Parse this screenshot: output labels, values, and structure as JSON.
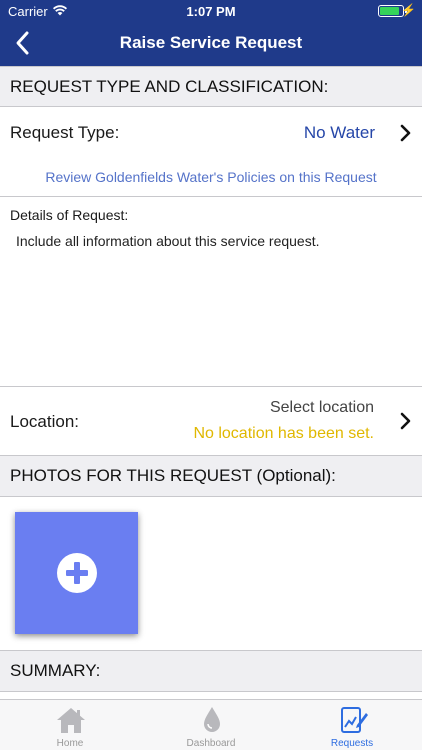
{
  "status_bar": {
    "carrier": "Carrier",
    "time": "1:07 PM",
    "charging_symbol": "⚡"
  },
  "nav": {
    "title": "Raise Service Request",
    "back_icon": "chevron-left-icon"
  },
  "sections": {
    "request_type": "REQUEST TYPE AND CLASSIFICATION:",
    "photos": "PHOTOS FOR THIS REQUEST (Optional):",
    "summary": "SUMMARY:"
  },
  "request": {
    "type_label": "Request Type:",
    "type_value": "No Water",
    "policy_link": "Review Goldenfields Water's Policies on this Request",
    "details_label": "Details of Request:",
    "details_placeholder": "Include all information about this service request."
  },
  "location": {
    "label": "Location:",
    "select_text": "Select location",
    "status_text": "No location has been set."
  },
  "photos": {
    "add_icon": "plus-circle-icon"
  },
  "tabbar": {
    "tabs": [
      {
        "label": "Home",
        "icon": "house-icon",
        "active": false
      },
      {
        "label": "Dashboard",
        "icon": "water-drop-icon",
        "active": false
      },
      {
        "label": "Requests",
        "icon": "document-pen-icon",
        "active": true
      }
    ]
  },
  "colors": {
    "nav_bg": "#1f3a8a",
    "link": "#5573c9",
    "value": "#2546a8",
    "warning": "#e0b800",
    "accent_tab": "#2e6de0",
    "photo_button": "#6a7ef1"
  }
}
